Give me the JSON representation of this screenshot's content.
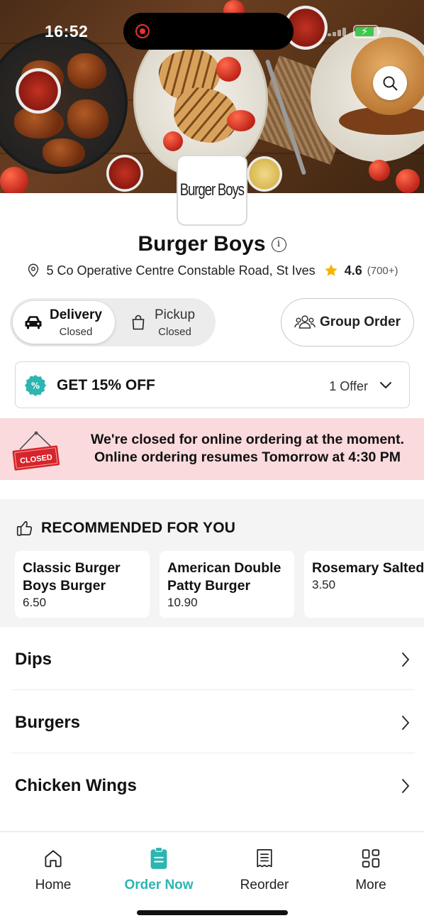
{
  "status_bar": {
    "time": "16:52"
  },
  "store": {
    "logo_text": "Burger Boys",
    "name": "Burger Boys",
    "address": "5 Co Operative Centre Constable Road, St Ives",
    "rating": "4.6",
    "rating_count": "(700+)"
  },
  "order_mode": {
    "options": [
      {
        "label": "Delivery",
        "status": "Closed",
        "selected": true
      },
      {
        "label": "Pickup",
        "status": "Closed",
        "selected": false
      }
    ],
    "group_order_label": "Group Order"
  },
  "offer": {
    "title": "GET 15% OFF",
    "count": "1 Offer"
  },
  "closed_banner": {
    "sign_text": "CLOSED",
    "line1": "We're closed for online ordering at the moment.",
    "line2": "Online ordering resumes Tomorrow at 4:30 PM"
  },
  "recommended": {
    "heading": "RECOMMENDED FOR YOU",
    "items": [
      {
        "name": "Classic Burger Boys Burger",
        "price": "6.50"
      },
      {
        "name": "American Double Patty Burger",
        "price": "10.90"
      },
      {
        "name": "Rosemary Salted Fries",
        "price": "3.50"
      }
    ]
  },
  "categories": [
    "Dips",
    "Burgers",
    "Chicken Wings"
  ],
  "bottom_nav": {
    "items": [
      {
        "label": "Home",
        "icon": "home-icon",
        "active": false
      },
      {
        "label": "Order Now",
        "icon": "order-icon",
        "active": true
      },
      {
        "label": "Reorder",
        "icon": "receipt-icon",
        "active": false
      },
      {
        "label": "More",
        "icon": "grid-icon",
        "active": false
      }
    ]
  },
  "colors": {
    "accent": "#2db5b0",
    "closed_banner_bg": "#fadadd",
    "closed_sign": "#d8232a",
    "star": "#f5b400"
  }
}
